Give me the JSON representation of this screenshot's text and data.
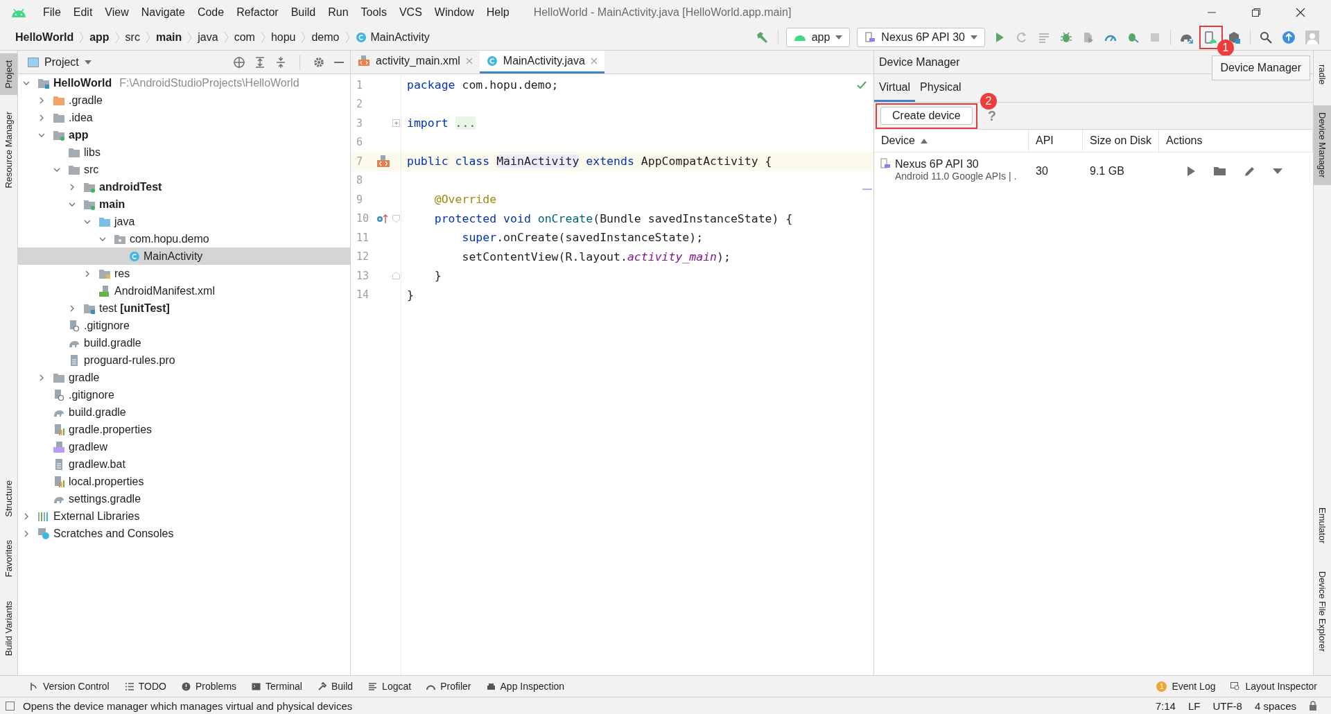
{
  "menu": [
    "File",
    "Edit",
    "View",
    "Navigate",
    "Code",
    "Refactor",
    "Build",
    "Run",
    "Tools",
    "VCS",
    "Window",
    "Help"
  ],
  "window": {
    "title": "HelloWorld - MainActivity.java [HelloWorld.app.main]"
  },
  "breadcrumbs": [
    {
      "label": "HelloWorld",
      "bold": true,
      "kind": "folder"
    },
    {
      "label": "app",
      "bold": true,
      "kind": "folder"
    },
    {
      "label": "src",
      "bold": false,
      "kind": "folder"
    },
    {
      "label": "main",
      "bold": true,
      "kind": "folder"
    },
    {
      "label": "java",
      "bold": false,
      "kind": "folder"
    },
    {
      "label": "com",
      "bold": false,
      "kind": "folder"
    },
    {
      "label": "hopu",
      "bold": false,
      "kind": "folder"
    },
    {
      "label": "demo",
      "bold": false,
      "kind": "folder"
    },
    {
      "label": "MainActivity",
      "bold": false,
      "kind": "class"
    }
  ],
  "toolbar": {
    "config": "app",
    "device": "Nexus 6P API 30",
    "tooltip": "Device Manager"
  },
  "annotations": [
    {
      "label": "1"
    },
    {
      "label": "2"
    }
  ],
  "left_strip": [
    {
      "label": "Project",
      "selected": true
    },
    {
      "label": "Resource Manager",
      "selected": false
    },
    {
      "label": "Structure",
      "selected": false
    },
    {
      "label": "Favorites",
      "selected": false
    },
    {
      "label": "Build Variants",
      "selected": false
    }
  ],
  "project_panel": {
    "title": "Project",
    "tree": [
      {
        "label": "HelloWorld",
        "hint": "F:\\AndroidStudioProjects\\HelloWorld",
        "kind": "project",
        "bold": true,
        "selected": false,
        "expanded": true,
        "children": [
          {
            "label": ".gradle",
            "kind": "excluded",
            "bold": false,
            "selected": false,
            "expanded": false
          },
          {
            "label": ".idea",
            "kind": "folder",
            "bold": false,
            "selected": false,
            "expanded": false
          },
          {
            "label": "app",
            "kind": "module",
            "bold": true,
            "selected": false,
            "expanded": true,
            "children": [
              {
                "label": "libs",
                "kind": "folder",
                "bold": false,
                "selected": false
              },
              {
                "label": "src",
                "kind": "folder",
                "bold": false,
                "selected": false,
                "expanded": true,
                "children": [
                  {
                    "label": "androidTest",
                    "kind": "module",
                    "bold": true,
                    "selected": false,
                    "expanded": false
                  },
                  {
                    "label": "main",
                    "kind": "module",
                    "bold": true,
                    "selected": false,
                    "expanded": true,
                    "children": [
                      {
                        "label": "java",
                        "kind": "source",
                        "bold": false,
                        "selected": false,
                        "expanded": true,
                        "children": [
                          {
                            "label": "com.hopu.demo",
                            "kind": "package",
                            "bold": false,
                            "selected": false,
                            "expanded": true,
                            "children": [
                              {
                                "label": "MainActivity",
                                "kind": "class",
                                "bold": false,
                                "selected": true
                              }
                            ]
                          }
                        ]
                      },
                      {
                        "label": "res",
                        "kind": "res",
                        "bold": false,
                        "selected": false,
                        "expanded": false
                      },
                      {
                        "label": "AndroidManifest.xml",
                        "kind": "manifest",
                        "bold": false,
                        "selected": false
                      }
                    ]
                  },
                  {
                    "label": "test **[unitTest]**",
                    "kind": "test",
                    "bold": false,
                    "selected": false,
                    "expanded": false
                  }
                ]
              },
              {
                "label": ".gitignore",
                "kind": "ignore",
                "bold": false,
                "selected": false
              },
              {
                "label": "build.gradle",
                "kind": "gradle",
                "bold": false,
                "selected": false
              },
              {
                "label": "proguard-rules.pro",
                "kind": "file",
                "bold": false,
                "selected": false
              }
            ]
          },
          {
            "label": "gradle",
            "kind": "folder",
            "bold": false,
            "selected": false,
            "expanded": false
          },
          {
            "label": ".gitignore",
            "kind": "ignore",
            "bold": false,
            "selected": false
          },
          {
            "label": "build.gradle",
            "kind": "gradle",
            "bold": false,
            "selected": false
          },
          {
            "label": "gradle.properties",
            "kind": "properties",
            "bold": false,
            "selected": false
          },
          {
            "label": "gradlew",
            "kind": "script",
            "bold": false,
            "selected": false
          },
          {
            "label": "gradlew.bat",
            "kind": "file",
            "bold": false,
            "selected": false
          },
          {
            "label": "local.properties",
            "kind": "properties",
            "bold": false,
            "selected": false
          },
          {
            "label": "settings.gradle",
            "kind": "gradle",
            "bold": false,
            "selected": false
          }
        ]
      },
      {
        "label": "External Libraries",
        "kind": "libraries",
        "bold": false,
        "selected": false,
        "expanded": false
      },
      {
        "label": "Scratches and Consoles",
        "kind": "scratches",
        "bold": false,
        "selected": false,
        "expanded": false
      }
    ]
  },
  "editor": {
    "tabs": [
      {
        "label": "activity_main.xml",
        "kind": "xml",
        "selected": false
      },
      {
        "label": "MainActivity.java",
        "kind": "class",
        "selected": true
      }
    ],
    "lines": [
      {
        "number": "1",
        "current": false,
        "kind": "plain",
        "tokens": [
          {
            "kind": "kw",
            "text": "package"
          },
          {
            "kind": "plain",
            "text": " com.hopu.demo;"
          }
        ]
      },
      {
        "number": "2",
        "current": false,
        "kind": "plain"
      },
      {
        "number": "3",
        "current": false,
        "kind": "folded",
        "tokens": [
          {
            "kind": "kw",
            "text": "import "
          },
          {
            "kind": "folded",
            "text": "..."
          }
        ]
      },
      {
        "number": "6",
        "current": false,
        "kind": "plain"
      },
      {
        "number": "7",
        "current": true,
        "kind": "class",
        "tokens": [
          {
            "kind": "kw",
            "text": "public class "
          },
          {
            "kind": "usage",
            "text": "MainActivity"
          },
          {
            "kind": "kw",
            "text": " extends"
          },
          {
            "kind": "plain",
            "text": " AppCompatActivity {"
          }
        ]
      },
      {
        "number": "8",
        "current": false,
        "kind": "plain"
      },
      {
        "number": "9",
        "current": false,
        "kind": "plain",
        "tokens": [
          {
            "kind": "annotation",
            "text": "    @Override"
          }
        ]
      },
      {
        "number": "10",
        "current": false,
        "kind": "override",
        "tokens": [
          {
            "kind": "kw",
            "text": "    protected void "
          },
          {
            "kind": "method",
            "text": "onCreate"
          },
          {
            "kind": "plain",
            "text": "(Bundle savedInstanceState) {"
          }
        ]
      },
      {
        "number": "11",
        "current": false,
        "kind": "plain",
        "tokens": [
          {
            "kind": "kw",
            "text": "        super"
          },
          {
            "kind": "plain",
            "text": ".onCreate(savedInstanceState);"
          }
        ]
      },
      {
        "number": "12",
        "current": false,
        "kind": "plain",
        "tokens": [
          {
            "kind": "plain",
            "text": "        setContentView(R.layout."
          },
          {
            "kind": "field",
            "text": "activity_main"
          },
          {
            "kind": "plain",
            "text": ");"
          }
        ]
      },
      {
        "number": "13",
        "current": false,
        "kind": "block-end",
        "tokens": [
          {
            "kind": "plain",
            "text": "    }"
          }
        ]
      },
      {
        "number": "14",
        "current": false,
        "kind": "plain",
        "tokens": [
          {
            "kind": "plain",
            "text": "}"
          }
        ]
      }
    ]
  },
  "device_manager": {
    "title": "Device Manager",
    "tabs": [
      {
        "label": "Virtual",
        "selected": true
      },
      {
        "label": "Physical",
        "selected": false
      }
    ],
    "create_button": "Create device",
    "help": "?",
    "columns": [
      {
        "label": "Device",
        "sorted": true
      },
      {
        "label": "API",
        "sorted": false
      },
      {
        "label": "Size on Disk",
        "sorted": false
      },
      {
        "label": "Actions",
        "sorted": false
      }
    ],
    "rows": [
      {
        "name": "Nexus 6P API 30",
        "detail": "Android 11.0 Google APIs | .",
        "api": "30",
        "size": "9.1 GB"
      }
    ]
  },
  "right_strip": [
    {
      "label": "radle",
      "selected": false
    },
    {
      "label": "Device Manager",
      "selected": true
    },
    {
      "label": "Emulator",
      "selected": false
    },
    {
      "label": "Device File Explorer",
      "selected": false
    }
  ],
  "tool_windows": [
    "Version Control",
    "TODO",
    "Problems",
    "Terminal",
    "Build",
    "Logcat",
    "Profiler",
    "App Inspection"
  ],
  "right_tools": [
    {
      "label": "Event Log",
      "badge": "1"
    },
    {
      "label": "Layout Inspector"
    }
  ],
  "status_bar": {
    "message": "Opens the device manager which manages virtual and physical devices",
    "items": [
      "7:14",
      "LF",
      "UTF-8",
      "4 spaces"
    ]
  }
}
